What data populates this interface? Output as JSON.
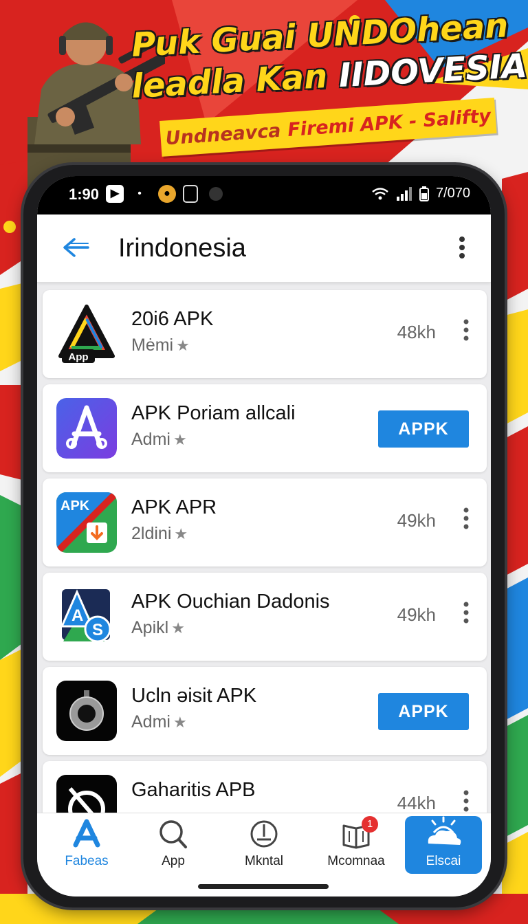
{
  "banner": {
    "line1": "Puk Guai UNDOhean",
    "line2_a": "leadla Kan",
    "line2_b": "IIDOVESIA",
    "strip_a": "Undneavca",
    "strip_b": "Firemi APK - Salifty"
  },
  "status_bar": {
    "time": "1:90",
    "right_text": "7/070"
  },
  "app_bar": {
    "back_icon": "arrow-left-icon",
    "title": "Irindonesia",
    "menu_icon": "more-vertical-icon"
  },
  "apps": [
    {
      "name": "20i6 APK",
      "sub": "Mėmi",
      "size": "48kh",
      "icon_text": "App",
      "action": "menu"
    },
    {
      "name": "APK Poriam allcali",
      "sub": "Admi",
      "button": "APPK",
      "action": "button"
    },
    {
      "name": "APK APR",
      "sub": "2ldini",
      "size": "49kh",
      "icon_text": "APK",
      "action": "menu"
    },
    {
      "name": "APK Ouchian Dadonis",
      "sub": "Apikl",
      "size": "49kh",
      "action": "menu"
    },
    {
      "name": "Ucln əisit APK",
      "sub": "Admi",
      "button": "APPK",
      "action": "button"
    },
    {
      "name": "Gaharitis APB",
      "sub": "",
      "size": "44kh",
      "action": "menu"
    }
  ],
  "bottom_nav": [
    {
      "label": "Fabeas",
      "icon": "store-a-icon",
      "active": true
    },
    {
      "label": "App",
      "icon": "search-icon",
      "active": false
    },
    {
      "label": "Mkntal",
      "icon": "clock-icon",
      "active": false
    },
    {
      "label": "Mcomnaa",
      "icon": "book-icon",
      "active": false,
      "badge": "1"
    },
    {
      "label": "Elscai",
      "icon": "weather-icon",
      "active": false,
      "highlight": true
    }
  ],
  "colors": {
    "accent": "#1f86df",
    "banner_red": "#d8231f",
    "banner_yellow": "#ffd61a"
  }
}
